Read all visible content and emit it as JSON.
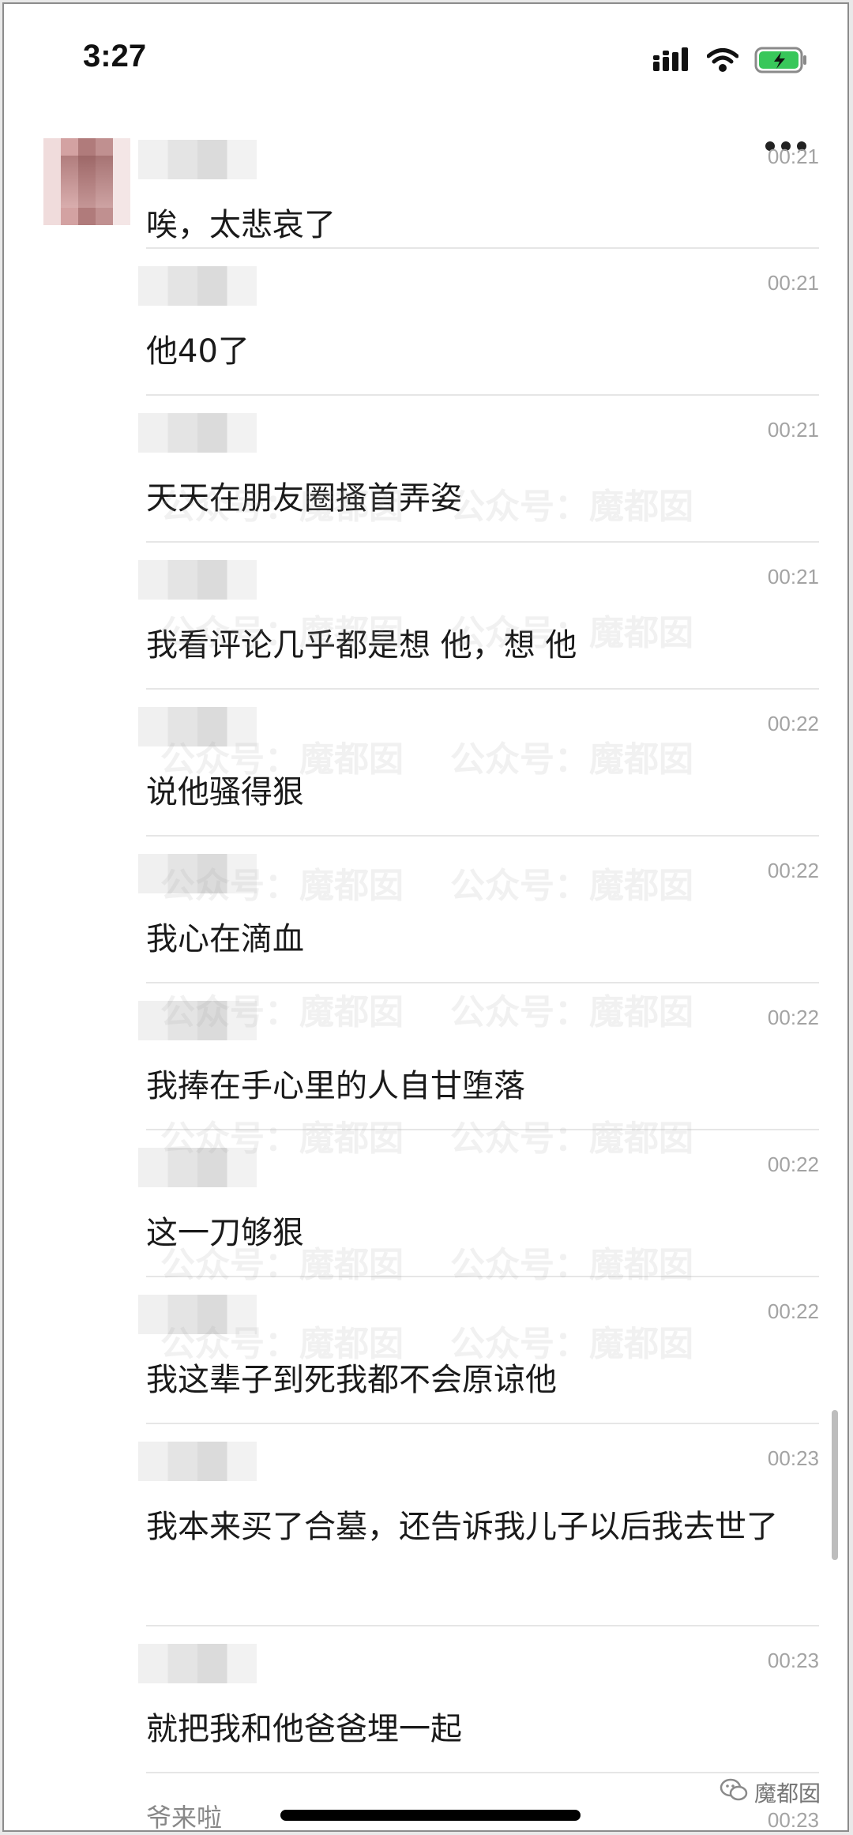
{
  "status_bar": {
    "time": "3:27"
  },
  "messages": [
    {
      "time": "00:21",
      "text": "唉，太悲哀了"
    },
    {
      "time": "00:21",
      "text": "他40了"
    },
    {
      "time": "00:21",
      "text": "天天在朋友圈搔首弄姿"
    },
    {
      "time": "00:21",
      "text": "我看评论几乎都是想  他，想  他"
    },
    {
      "time": "00:22",
      "text": "说他骚得狠"
    },
    {
      "time": "00:22",
      "text": "我心在滴血"
    },
    {
      "time": "00:22",
      "text": "我捧在手心里的人自甘堕落"
    },
    {
      "time": "00:22",
      "text": "这一刀够狠"
    },
    {
      "time": "00:22",
      "text": "我这辈子到死我都不会原谅他"
    },
    {
      "time": "00:23",
      "text": "我本来买了合墓，还告诉我儿子以后我去世了"
    },
    {
      "time": "00:23",
      "text": "就把我和他爸爸埋一起"
    },
    {
      "time": "00:23",
      "text": "爷来啦"
    }
  ],
  "watermark": {
    "text": "公众号：魔都囡"
  },
  "corner_brand": {
    "text": "魔都囡"
  },
  "colors": {
    "battery": "#38c75a",
    "time_text": "#a3a3a3",
    "message_text": "#1a1a1a"
  },
  "icons": [
    "signal-icon",
    "wifi-icon",
    "battery-charging-icon",
    "more-icon",
    "wechat-brand-icon"
  ]
}
